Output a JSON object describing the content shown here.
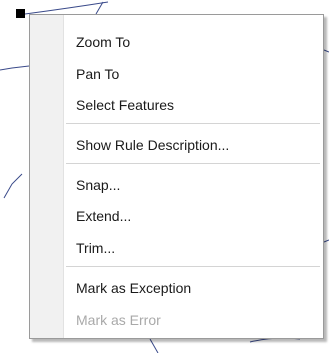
{
  "context_menu": {
    "items": [
      {
        "label": "Zoom To",
        "enabled": true
      },
      {
        "label": "Pan To",
        "enabled": true
      },
      {
        "label": "Select Features",
        "enabled": true
      },
      {
        "label": "Show Rule Description...",
        "enabled": true
      },
      {
        "label": "Snap...",
        "enabled": true
      },
      {
        "label": "Extend...",
        "enabled": true
      },
      {
        "label": "Trim...",
        "enabled": true
      },
      {
        "label": "Mark as Exception",
        "enabled": true
      },
      {
        "label": "Mark as Error",
        "enabled": false
      }
    ]
  },
  "colors": {
    "map_line": "#3a4a8a",
    "menu_text": "#1a1a1a",
    "disabled_text": "#a9a9a9",
    "menu_border": "#9a9a9a"
  }
}
